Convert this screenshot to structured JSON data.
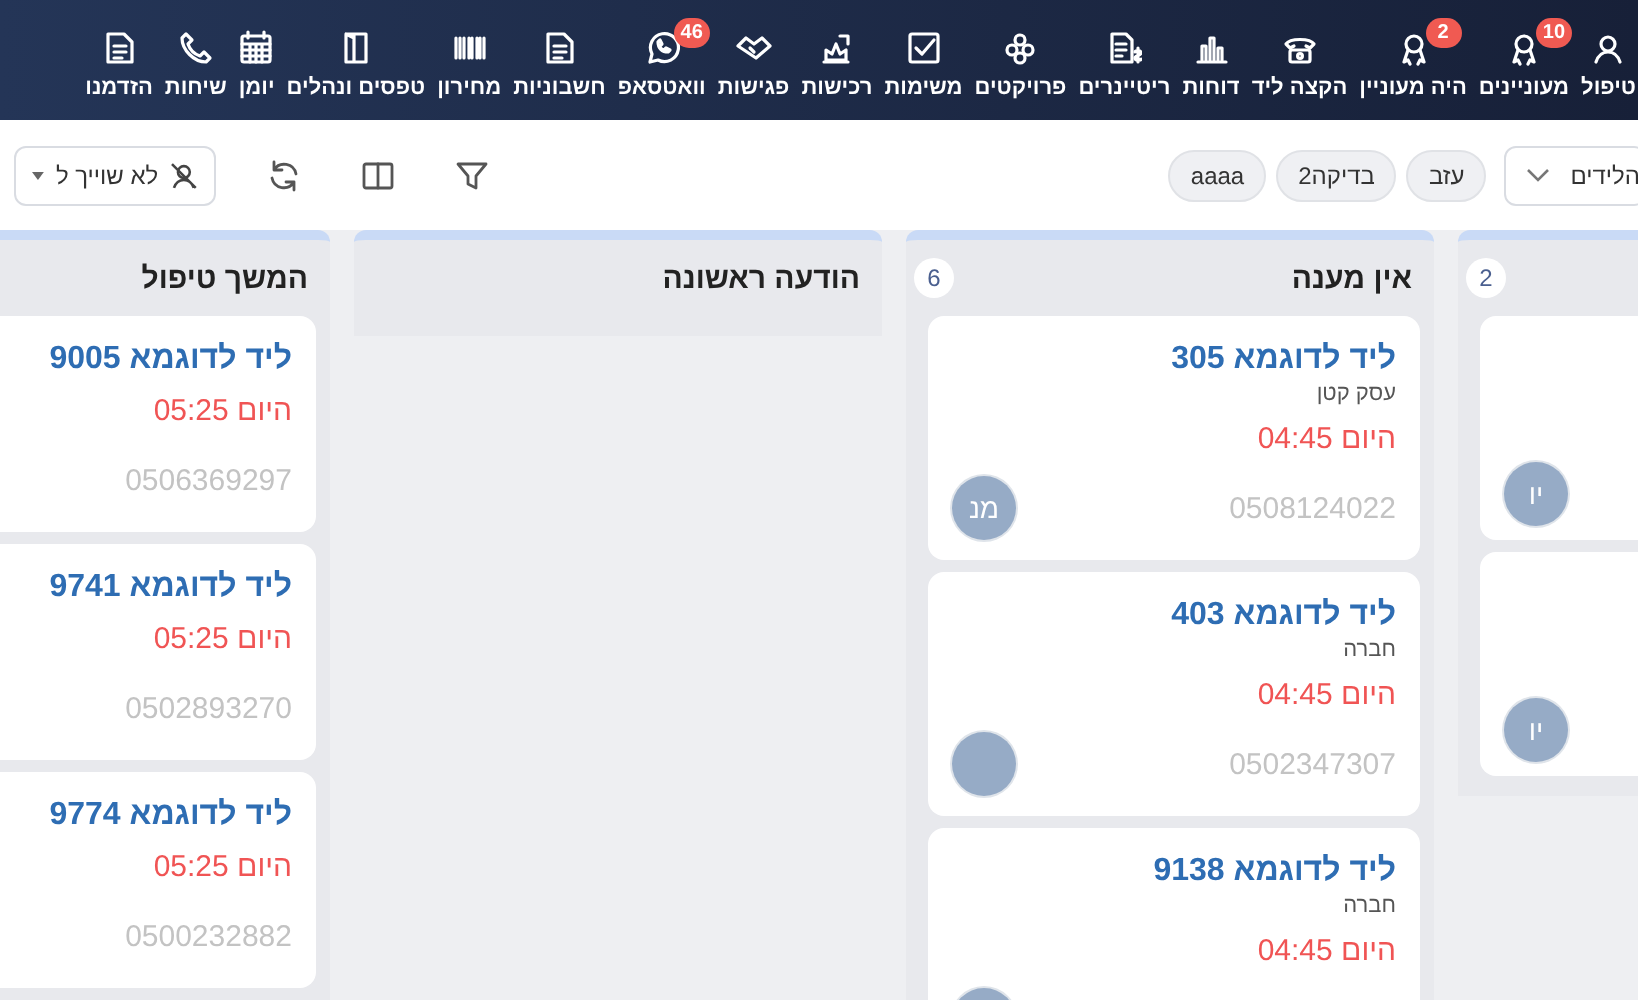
{
  "nav": {
    "items": [
      {
        "label": "טיפול"
      },
      {
        "label": "מעוניינים",
        "badge": "10"
      },
      {
        "label": "היה מעוניין",
        "badge": "2"
      },
      {
        "label": "הקצה ליד"
      },
      {
        "label": "דוחות"
      },
      {
        "label": "ריטיינרים"
      },
      {
        "label": "פרויקטים"
      },
      {
        "label": "משימות"
      },
      {
        "label": "רכישות"
      },
      {
        "label": "פגישות"
      },
      {
        "label": "וואטסאפ",
        "badge": "46"
      },
      {
        "label": "חשבוניות"
      },
      {
        "label": "מחירון"
      },
      {
        "label": "טפסים ונהלים"
      },
      {
        "label": "יומן"
      },
      {
        "label": "שיחות"
      },
      {
        "label": "הזדמנו"
      }
    ]
  },
  "toolbar": {
    "stage_select": {
      "value": "הלידים"
    },
    "tags": [
      {
        "label": "עזב"
      },
      {
        "label": "בדיקה2"
      },
      {
        "label": "aaaa"
      }
    ],
    "assignee_filter": {
      "label": "לא שוייך ל"
    }
  },
  "columns": [
    {
      "count": "2",
      "cards": [
        {
          "avatar": true,
          "initials": "יו"
        },
        {
          "avatar": true,
          "initials": "יו"
        }
      ]
    },
    {
      "title": "אין מענה",
      "count": "6",
      "cards": [
        {
          "title": "ליד לדוגמא 305",
          "subtitle": "עסק קטן",
          "time": "היום 04:45",
          "phone": "0508124022",
          "avatar": true,
          "initials": "מנ"
        },
        {
          "title": "ליד לדוגמא 403",
          "subtitle": "חברה",
          "time": "היום 04:45",
          "phone": "0502347307",
          "avatar": true
        },
        {
          "title": "ליד לדוגמא 9138",
          "subtitle": "חברה",
          "time": "היום 04:45",
          "avatar": true
        }
      ]
    },
    {
      "title": "הודעה ראשונה"
    },
    {
      "title": "המשך טיפול",
      "cards": [
        {
          "title": "ליד לדוגמא 9005",
          "time": "היום 05:25",
          "phone": "0506369297"
        },
        {
          "title": "ליד לדוגמא 9741",
          "time": "היום 05:25",
          "phone": "0502893270"
        },
        {
          "title": "ליד לדוגמא 9774",
          "time": "היום 05:25",
          "phone": "0500232882"
        }
      ]
    }
  ]
}
